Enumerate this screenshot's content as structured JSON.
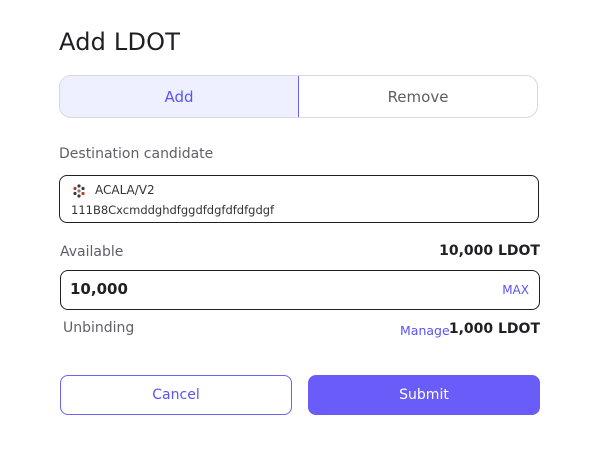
{
  "title": "Add LDOT",
  "tabs": [
    {
      "label": "Add",
      "active": true
    },
    {
      "label": "Remove",
      "active": false
    }
  ],
  "destination": {
    "label": "Destination candidate",
    "candidate_name": "ACALA/V2",
    "candidate_address": "111B8Cxcmddghdfggdfdgfdfdfgdgf",
    "icon": "identicon-icon"
  },
  "available": {
    "label": "Available",
    "value": "10,000 LDOT"
  },
  "amount": {
    "value": "10,000",
    "max_label": "MAX"
  },
  "unbinding": {
    "label": "Unbinding",
    "manage_label": "Manage",
    "value": "1,000 LDOT"
  },
  "actions": {
    "cancel_label": "Cancel",
    "submit_label": "Submit"
  },
  "colors": {
    "accent": "#5b54f5",
    "accent_light": "#eeefff",
    "submit_bg": "#6a5cf8",
    "border_dark": "#1f1f24"
  }
}
